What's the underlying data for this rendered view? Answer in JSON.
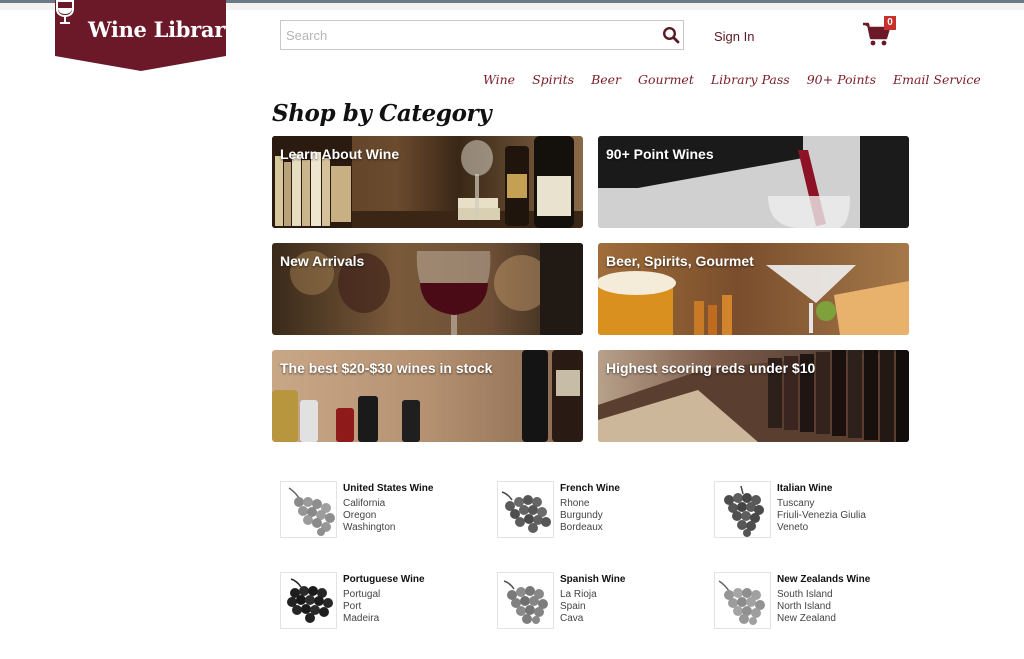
{
  "brand": {
    "name": "Wine Library",
    "color": "#6b1828"
  },
  "search": {
    "placeholder": "Search"
  },
  "header": {
    "signin_label": "Sign In",
    "cart_count": "0"
  },
  "nav": [
    "Wine",
    "Spirits",
    "Beer",
    "Gourmet",
    "Library Pass",
    "90+ Points",
    "Email Service"
  ],
  "main": {
    "heading": "Shop by Category",
    "tiles": [
      "Learn About Wine",
      "90+ Point Wines",
      "New Arrivals",
      "Beer, Spirits, Gourmet",
      "The best $20-$30 wines in stock",
      "Highest scoring reds under $10"
    ]
  },
  "regions": [
    {
      "title": "United States Wine",
      "links": [
        "California",
        "Oregon",
        "Washington"
      ]
    },
    {
      "title": "French Wine",
      "links": [
        "Rhone",
        "Burgundy",
        "Bordeaux"
      ]
    },
    {
      "title": "Italian Wine",
      "links": [
        "Tuscany",
        "Friuli-Venezia Giulia",
        "Veneto"
      ]
    },
    {
      "title": "Portuguese Wine",
      "links": [
        "Portugal",
        "Port",
        "Madeira"
      ]
    },
    {
      "title": "Spanish Wine",
      "links": [
        "La Rioja",
        "Spain",
        "Cava"
      ]
    },
    {
      "title": "New Zealands Wine",
      "links": [
        "South Island",
        "North Island",
        "New Zealand"
      ]
    }
  ]
}
